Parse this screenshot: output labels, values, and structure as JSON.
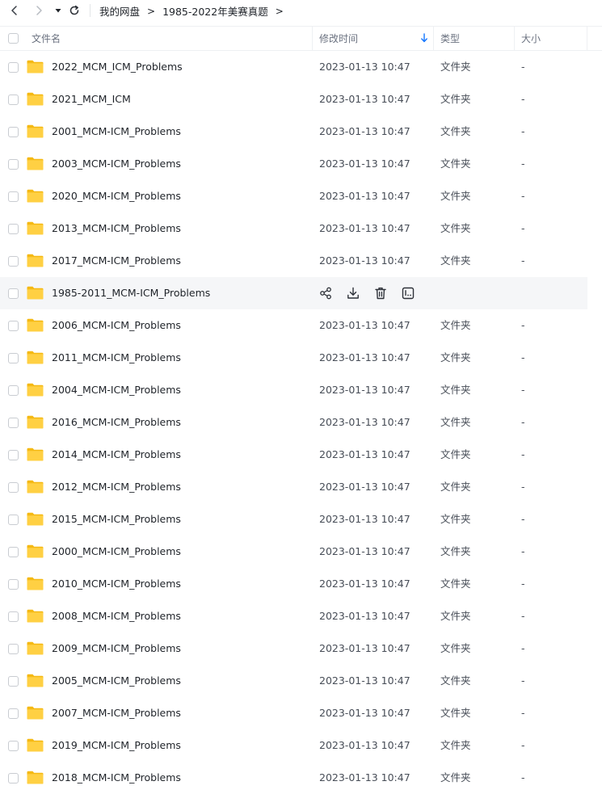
{
  "nav": {
    "back_icon": "chevron-left-icon",
    "forward_icon": "chevron-right-icon",
    "dropdown_icon": "caret-down-icon",
    "refresh_icon": "refresh-icon"
  },
  "breadcrumb": {
    "items": [
      "我的网盘",
      "1985-2022年美赛真题"
    ],
    "separator": ">"
  },
  "header": {
    "name": "文件名",
    "modified": "修改时间",
    "type": "类型",
    "size": "大小"
  },
  "colors": {
    "folder": "#ffcf3f",
    "folder_tab": "#f5b914",
    "sort_arrow": "#1677ff",
    "row_hover": "#f5f6f8"
  },
  "rows": [
    {
      "name": "2022_MCM_ICM_Problems",
      "time": "2023-01-13 10:47",
      "type": "文件夹",
      "size": "-"
    },
    {
      "name": "2021_MCM_ICM",
      "time": "2023-01-13 10:47",
      "type": "文件夹",
      "size": "-"
    },
    {
      "name": "2001_MCM-ICM_Problems",
      "time": "2023-01-13 10:47",
      "type": "文件夹",
      "size": "-"
    },
    {
      "name": "2003_MCM-ICM_Problems",
      "time": "2023-01-13 10:47",
      "type": "文件夹",
      "size": "-"
    },
    {
      "name": "2020_MCM-ICM_Problems",
      "time": "2023-01-13 10:47",
      "type": "文件夹",
      "size": "-"
    },
    {
      "name": "2013_MCM-ICM_Problems",
      "time": "2023-01-13 10:47",
      "type": "文件夹",
      "size": "-"
    },
    {
      "name": "2017_MCM-ICM_Problems",
      "time": "2023-01-13 10:47",
      "type": "文件夹",
      "size": "-"
    },
    {
      "name": "1985-2011_MCM-ICM_Problems",
      "time": "",
      "type": "",
      "size": "",
      "hover": true,
      "actions": [
        "share-icon",
        "download-icon",
        "delete-icon",
        "more-icon"
      ]
    },
    {
      "name": "2006_MCM-ICM_Problems",
      "time": "2023-01-13 10:47",
      "type": "文件夹",
      "size": "-"
    },
    {
      "name": "2011_MCM-ICM_Problems",
      "time": "2023-01-13 10:47",
      "type": "文件夹",
      "size": "-"
    },
    {
      "name": "2004_MCM-ICM_Problems",
      "time": "2023-01-13 10:47",
      "type": "文件夹",
      "size": "-"
    },
    {
      "name": "2016_MCM-ICM_Problems",
      "time": "2023-01-13 10:47",
      "type": "文件夹",
      "size": "-"
    },
    {
      "name": "2014_MCM-ICM_Problems",
      "time": "2023-01-13 10:47",
      "type": "文件夹",
      "size": "-"
    },
    {
      "name": "2012_MCM-ICM_Problems",
      "time": "2023-01-13 10:47",
      "type": "文件夹",
      "size": "-"
    },
    {
      "name": "2015_MCM-ICM_Problems",
      "time": "2023-01-13 10:47",
      "type": "文件夹",
      "size": "-"
    },
    {
      "name": "2000_MCM-ICM_Problems",
      "time": "2023-01-13 10:47",
      "type": "文件夹",
      "size": "-"
    },
    {
      "name": "2010_MCM-ICM_Problems",
      "time": "2023-01-13 10:47",
      "type": "文件夹",
      "size": "-"
    },
    {
      "name": "2008_MCM-ICM_Problems",
      "time": "2023-01-13 10:47",
      "type": "文件夹",
      "size": "-"
    },
    {
      "name": "2009_MCM-ICM_Problems",
      "time": "2023-01-13 10:47",
      "type": "文件夹",
      "size": "-"
    },
    {
      "name": "2005_MCM-ICM_Problems",
      "time": "2023-01-13 10:47",
      "type": "文件夹",
      "size": "-"
    },
    {
      "name": "2007_MCM-ICM_Problems",
      "time": "2023-01-13 10:47",
      "type": "文件夹",
      "size": "-"
    },
    {
      "name": "2019_MCM-ICM_Problems",
      "time": "2023-01-13 10:47",
      "type": "文件夹",
      "size": "-"
    },
    {
      "name": "2018_MCM-ICM_Problems",
      "time": "2023-01-13 10:47",
      "type": "文件夹",
      "size": "-"
    }
  ]
}
